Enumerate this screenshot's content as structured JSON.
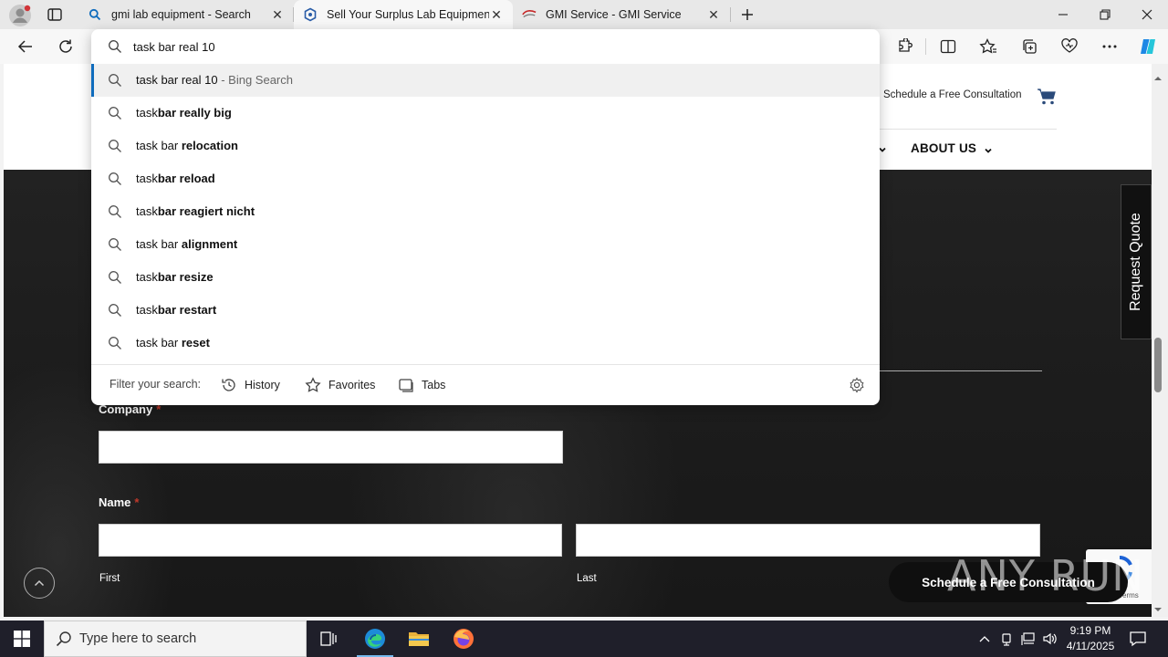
{
  "browser": {
    "tabs": [
      {
        "title": "gmi lab equipment - Search",
        "active": false
      },
      {
        "title": "Sell Your Surplus Lab Equipment",
        "active": true
      },
      {
        "title": "GMI Service - GMI Service",
        "active": false
      }
    ]
  },
  "omnibox": {
    "query": "task bar real 10",
    "suggestions": [
      {
        "pre": "task bar real 10",
        "bold": "",
        "post": "",
        "suffix": " - Bing Search",
        "selected": true
      },
      {
        "pre": "task",
        "bold": "bar rea",
        "post": "",
        "bold2": "lly big",
        "suffix": ""
      },
      {
        "pre": "task bar ",
        "bold": "relocation",
        "post": "",
        "suffix": ""
      },
      {
        "pre": "task",
        "bold": "bar reload",
        "post": "",
        "suffix": ""
      },
      {
        "pre": "task",
        "bold": "bar reagiert nicht",
        "post": "",
        "suffix": ""
      },
      {
        "pre": "task bar ",
        "bold": "alignment",
        "post": "",
        "suffix": ""
      },
      {
        "pre": "task",
        "bold": "bar resize",
        "post": "",
        "suffix": ""
      },
      {
        "pre": "task",
        "bold": "bar restart",
        "post": "",
        "suffix": ""
      },
      {
        "pre": "task bar ",
        "bold": "reset",
        "post": "",
        "suffix": ""
      }
    ],
    "filter_label": "Filter your search:",
    "filters": [
      "History",
      "Favorites",
      "Tabs"
    ]
  },
  "site": {
    "header_link": "Schedule a Free Consultation",
    "nav_about": "ABOUT US",
    "request_quote": "Request Quote",
    "form": {
      "company_label": "Company",
      "name_label": "Name",
      "required_mark": "*",
      "first_label": "First",
      "last_label": "Last"
    },
    "cta_button": "Schedule a Free Consultation",
    "recaptcha_text": "Terms",
    "watermark": "ANY RUN"
  },
  "taskbar": {
    "search_placeholder": "Type here to search",
    "time": "9:19 PM",
    "date": "4/11/2025"
  },
  "colors": {
    "accent": "#0f6cbd",
    "taskbar": "#1f1f2a",
    "hero": "#1d1d1d"
  }
}
